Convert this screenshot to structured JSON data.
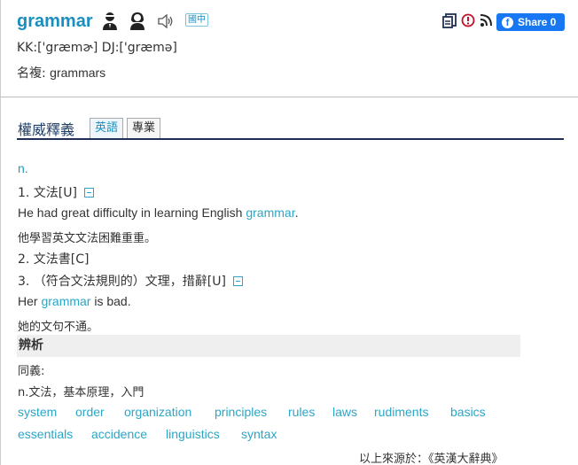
{
  "header": {
    "word": "grammar",
    "lang_badge": "國中",
    "share_label": "Share 0",
    "pronunciation": "KK:['græmɚ] DJ:['græmə]",
    "plural_label": "名複:",
    "plural_value": "grammars"
  },
  "icons": {
    "speaker_male": "male-speaker-icon",
    "speaker_female": "female-speaker-icon",
    "audio": "audio-icon",
    "copy": "copy-icon",
    "report": "report-icon",
    "rss": "rss-icon",
    "facebook": "facebook-icon"
  },
  "section": {
    "title": "權威釋義",
    "tabs": [
      "英語",
      "專業"
    ]
  },
  "entry": {
    "pos": "n.",
    "sense1": "1. 文法[U]",
    "ex1_pre": "He had great difficulty in learning English ",
    "ex1_word": "grammar",
    "ex1_post": ".",
    "ex1_zh": "他學習英文文法困難重重。",
    "sense2": "2. 文法書[C]",
    "sense3": "3. （符合文法規則的）文理，措辭[U]",
    "ex3_pre": "Her ",
    "ex3_word": "grammar",
    "ex3_post": " is bad.",
    "ex3_zh": "她的文句不通。"
  },
  "analysis": {
    "title": "辨析",
    "syn_label": "同義:",
    "syn_def": "n.文法，基本原理，入門",
    "synonyms": [
      "system",
      "order",
      "organization",
      "principles",
      "rules",
      "laws",
      "rudiments",
      "basics",
      "essentials",
      "accidence",
      "linguistics",
      "syntax"
    ]
  },
  "source": "以上來源於：《英漢大辭典》",
  "colors": {
    "word_blue": "#1a8fbf",
    "link_teal": "#2aa6c7",
    "facebook_blue": "#1877f2",
    "rule_navy": "#1f2f56"
  }
}
